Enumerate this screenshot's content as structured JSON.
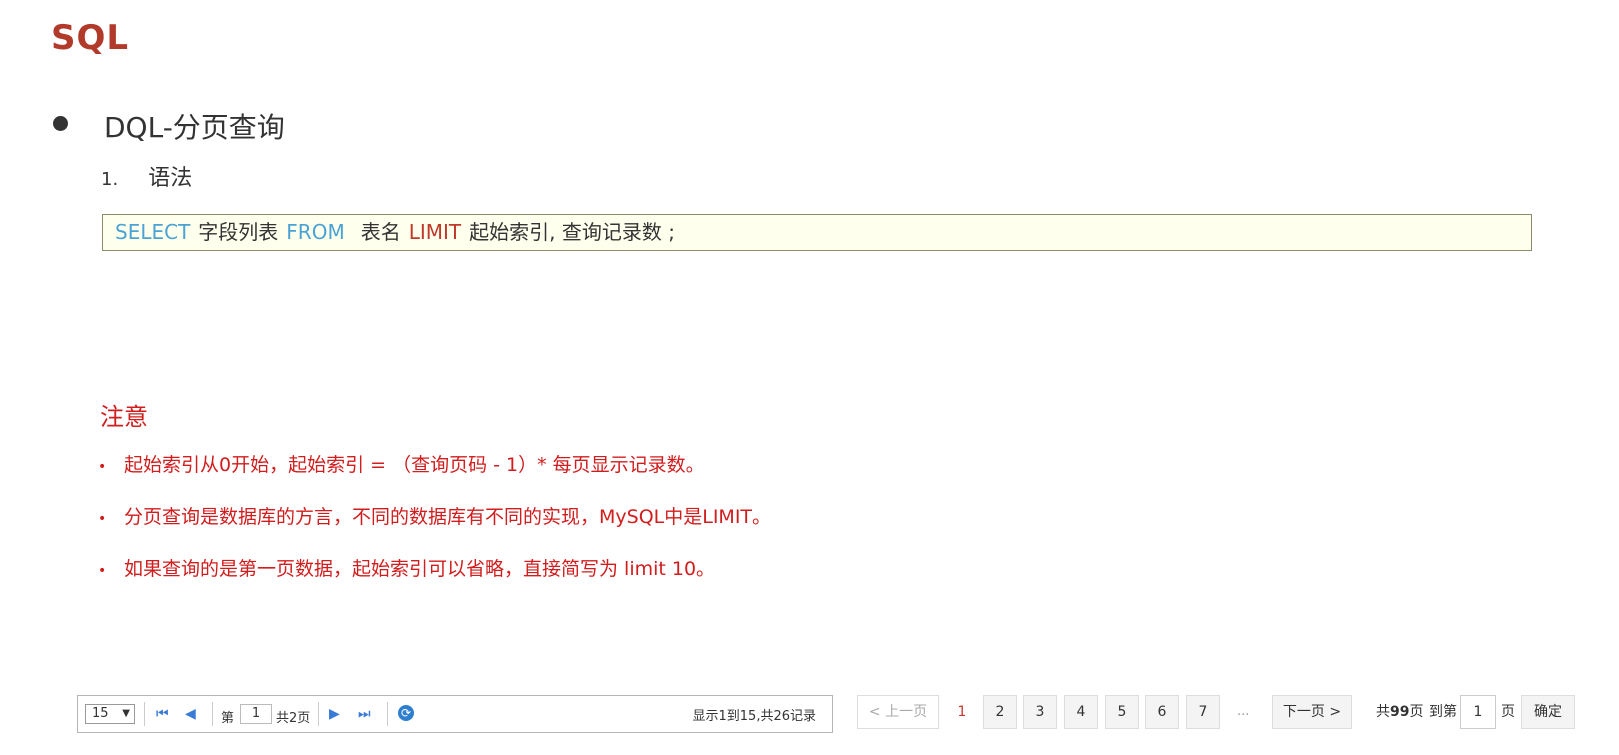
{
  "title": "SQL",
  "section": "DQL-分页查询",
  "numbered_item": {
    "num": "1.",
    "label": "语法"
  },
  "code": {
    "select": "SELECT",
    "fields": "字段列表",
    "from": "FROM",
    "table": "表名",
    "limit": "LIMIT",
    "args": "起始索引, 查询记录数 ;"
  },
  "note": {
    "title": "注意",
    "items": [
      "起始索引从0开始，起始索引 = （查询页码 - 1）* 每页显示记录数。",
      "分页查询是数据库的方言，不同的数据库有不同的实现，MySQL中是LIMIT。",
      "如果查询的是第一页数据，起始索引可以省略，直接简写为 limit 10。"
    ]
  },
  "pager_bar": {
    "page_size": "15",
    "page_prefix": "第",
    "page_value": "1",
    "page_total": "共2页",
    "info": "显示1到15,共26记录"
  },
  "pagination": {
    "prev": "< 上一页",
    "current": "1",
    "pages": [
      "2",
      "3",
      "4",
      "5",
      "6",
      "7"
    ],
    "ellipsis": "...",
    "next": "下一页 >",
    "total_prefix": "共",
    "total_pages": "99",
    "total_suffix": "页",
    "goto_label": "到第",
    "goto_value": "1",
    "page_label": "页",
    "confirm": "确定"
  },
  "colors": {
    "title": "#b23a2a",
    "keyword_blue": "#4aa3d4",
    "keyword_red": "#c0392b",
    "note_red": "#d11d1d",
    "code_bg": "#ffffee"
  }
}
